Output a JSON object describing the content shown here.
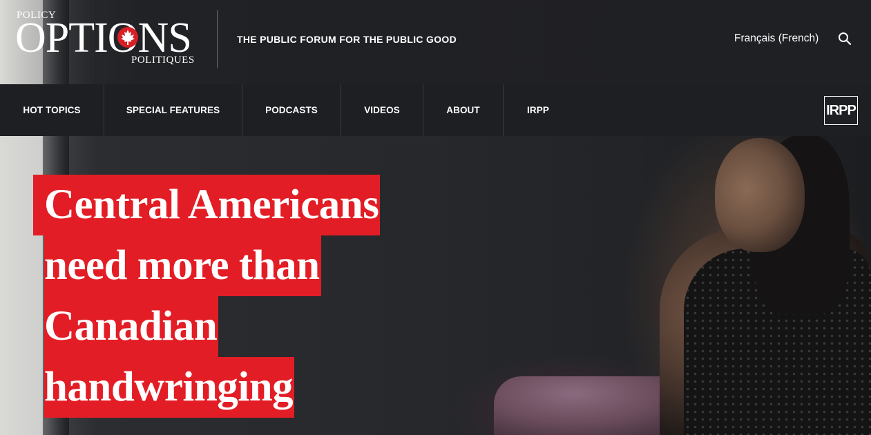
{
  "header": {
    "logo": {
      "top": "POLICY",
      "main": "OPTIONS",
      "bottom": "POLITIQUES"
    },
    "tagline": "THE PUBLIC FORUM FOR THE PUBLIC GOOD",
    "language_link": "Français (French)",
    "search_icon": "search-icon"
  },
  "nav": {
    "items": [
      {
        "label": "HOT TOPICS"
      },
      {
        "label": "SPECIAL FEATURES"
      },
      {
        "label": "PODCASTS"
      },
      {
        "label": "VIDEOS"
      },
      {
        "label": "ABOUT"
      },
      {
        "label": "IRPP"
      }
    ],
    "irpp_logo": "IRPP"
  },
  "hero": {
    "headline_lines": [
      "Central Americans",
      "need more than",
      "Canadian",
      "handwringing"
    ]
  },
  "colors": {
    "accent_red": "#e31d25",
    "nav_bg": "#1d1f23",
    "text": "#ffffff"
  }
}
